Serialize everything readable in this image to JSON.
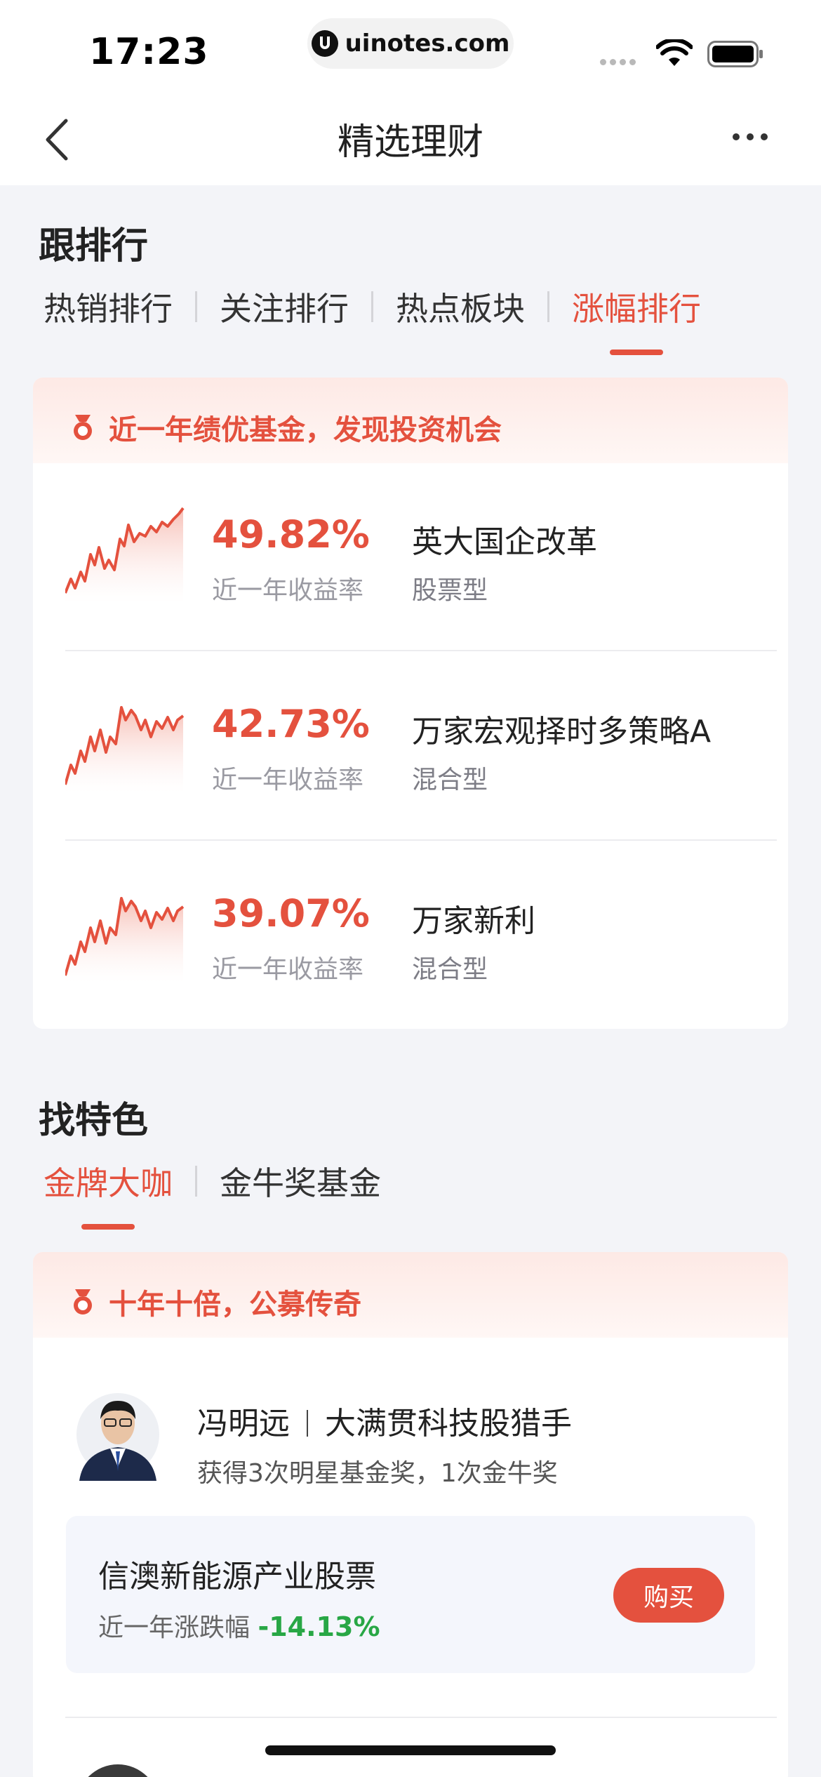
{
  "status_bar": {
    "time": "17:23",
    "url": "uinotes.com"
  },
  "nav": {
    "title": "精选理财"
  },
  "rank_section": {
    "title": "跟排行",
    "tabs": [
      "热销排行",
      "关注排行",
      "热点板块",
      "涨幅排行"
    ],
    "active_tab": "涨幅排行",
    "banner": "近一年绩优基金，发现投资机会",
    "funds": [
      {
        "return": "49.82%",
        "return_label": "近一年收益率",
        "name": "英大国企改革",
        "type": "股票型"
      },
      {
        "return": "42.73%",
        "return_label": "近一年收益率",
        "name": "万家宏观择时多策略A",
        "type": "混合型"
      },
      {
        "return": "39.07%",
        "return_label": "近一年收益率",
        "name": "万家新利",
        "type": "混合型"
      }
    ]
  },
  "feature_section": {
    "title": "找特色",
    "tabs": [
      "金牌大咖",
      "金牛奖基金"
    ],
    "active_tab": "金牌大咖",
    "banner": "十年十倍，公募传奇",
    "manager": {
      "name": "冯明远",
      "tagline": "大满贯科技股猎手",
      "awards": "获得3次明星基金奖，1次金牛奖"
    },
    "product": {
      "name": "信澳新能源产业股票",
      "change_label": "近一年涨跌幅",
      "change_value": "-14.13%",
      "buy_label": "购买"
    }
  },
  "colors": {
    "accent": "#e4513e",
    "negative": "#28a745"
  }
}
